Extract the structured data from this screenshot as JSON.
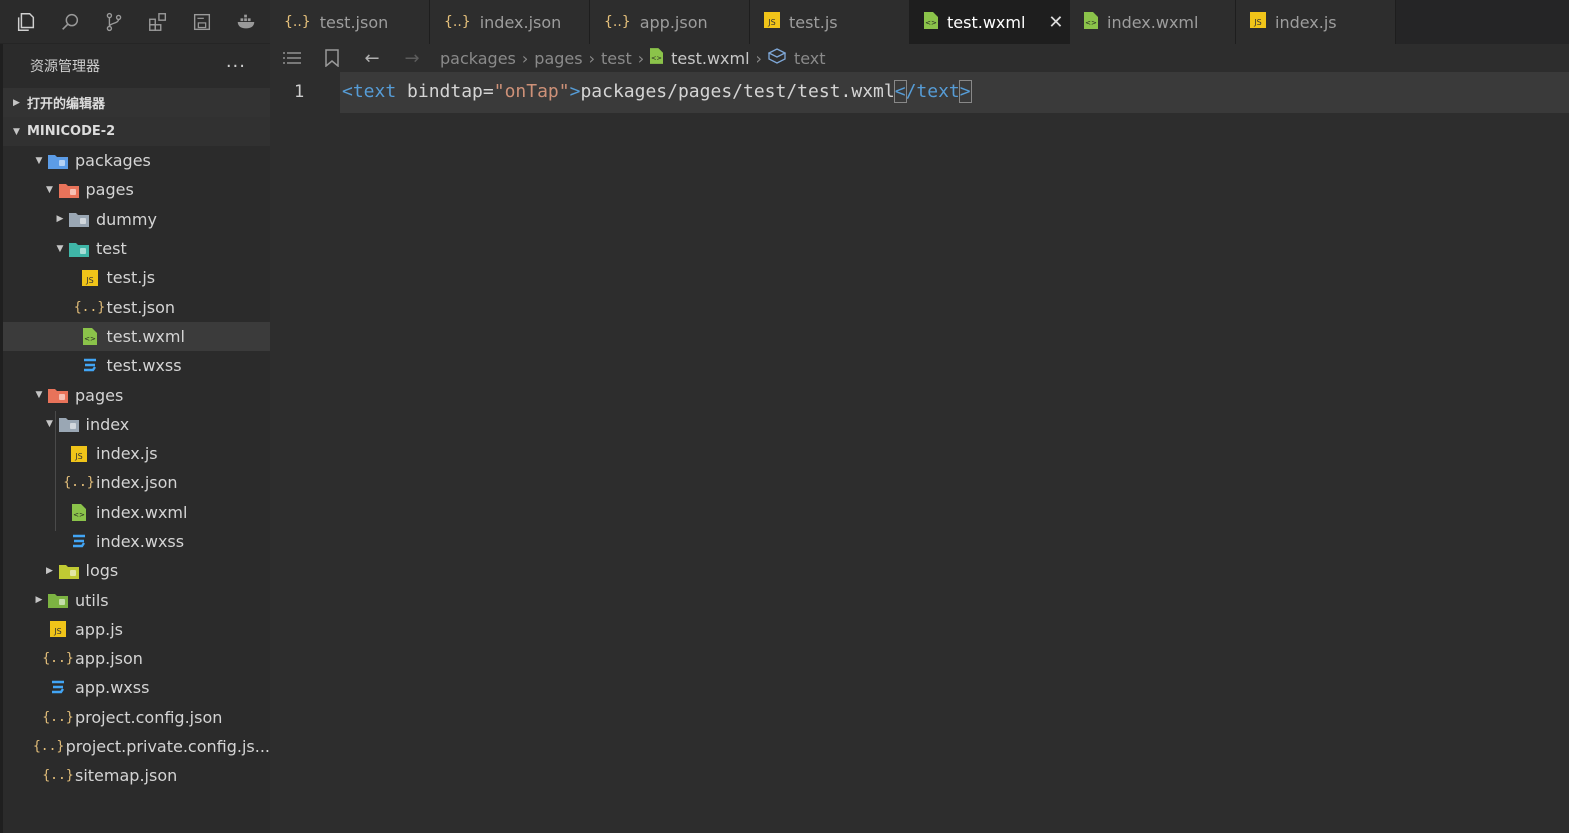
{
  "activity_bar": {
    "icons": [
      "explorer-icon",
      "search-icon",
      "source-control-icon",
      "extensions-icon",
      "save-icon",
      "debug-icon"
    ]
  },
  "tabs": [
    {
      "label": "test.json",
      "icon": "json",
      "active": false
    },
    {
      "label": "index.json",
      "icon": "json",
      "active": false
    },
    {
      "label": "app.json",
      "icon": "json",
      "active": false
    },
    {
      "label": "test.js",
      "icon": "js",
      "active": false
    },
    {
      "label": "test.wxml",
      "icon": "wxml",
      "active": true
    },
    {
      "label": "index.wxml",
      "icon": "wxml",
      "active": false
    },
    {
      "label": "index.js",
      "icon": "js",
      "active": false
    }
  ],
  "sidebar": {
    "title": "资源管理器",
    "more": "···",
    "sections": [
      {
        "label": "打开的编辑器"
      },
      {
        "label": "MINICODE-2"
      }
    ],
    "tree": [
      {
        "label": "packages",
        "icon": "folder-blue"
      },
      {
        "label": "pages",
        "icon": "folder-red"
      },
      {
        "label": "dummy",
        "icon": "folder-gray"
      },
      {
        "label": "test",
        "icon": "folder-teal"
      },
      {
        "label": "test.js",
        "icon": "js"
      },
      {
        "label": "test.json",
        "icon": "json"
      },
      {
        "label": "test.wxml",
        "icon": "wxml"
      },
      {
        "label": "test.wxss",
        "icon": "wxss"
      },
      {
        "label": "pages",
        "icon": "folder-red"
      },
      {
        "label": "index",
        "icon": "folder-open"
      },
      {
        "label": "index.js",
        "icon": "js"
      },
      {
        "label": "index.json",
        "icon": "json"
      },
      {
        "label": "index.wxml",
        "icon": "wxml"
      },
      {
        "label": "index.wxss",
        "icon": "wxss"
      },
      {
        "label": "logs",
        "icon": "folder-yellow"
      },
      {
        "label": "utils",
        "icon": "folder-green"
      },
      {
        "label": "app.js",
        "icon": "js"
      },
      {
        "label": "app.json",
        "icon": "json"
      },
      {
        "label": "app.wxss",
        "icon": "wxss"
      },
      {
        "label": "project.config.json",
        "icon": "json"
      },
      {
        "label": "project.private.config.js...",
        "icon": "json"
      },
      {
        "label": "sitemap.json",
        "icon": "json"
      }
    ]
  },
  "breadcrumb": [
    "packages",
    "pages",
    "test",
    "test.wxml",
    "text"
  ],
  "editor": {
    "line_number": "1",
    "tag_open": "<text",
    "attr_name": " bindtap=",
    "attr_value": "\"onTap\"",
    "gt": ">",
    "content": "packages/pages/test/test.wxml",
    "close_lt": "<",
    "close_tag": "/text",
    "close_gt": ">"
  },
  "colors": {
    "json": "#e5c07b",
    "js": "#f0c419",
    "wxml": "#8bc34a",
    "wxss": "#42a5f5",
    "tag": "#569cd6",
    "string": "#ce9178"
  }
}
